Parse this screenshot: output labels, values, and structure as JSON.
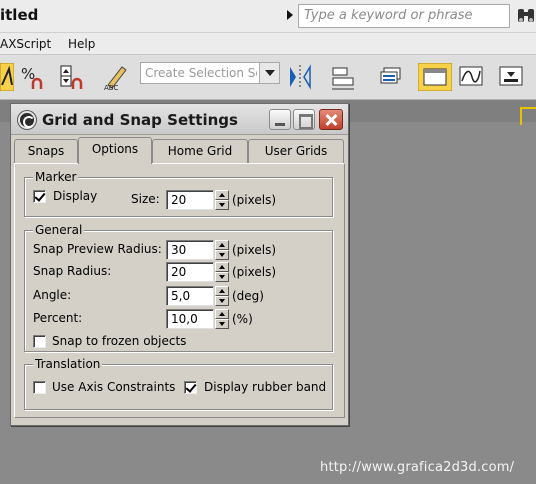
{
  "app": {
    "title": "itled",
    "search_placeholder": "Type a keyword or phrase",
    "menu": [
      "AXScript",
      "Help"
    ],
    "selection_set_placeholder": "Create Selection Se"
  },
  "dialog": {
    "title": "Grid and Snap Settings",
    "tabs": [
      {
        "label": "Snaps",
        "active": false
      },
      {
        "label": "Options",
        "active": true
      },
      {
        "label": "Home Grid",
        "active": false
      },
      {
        "label": "User Grids",
        "active": false
      }
    ],
    "marker": {
      "group_label": "Marker",
      "display_label": "Display",
      "display_checked": true,
      "size_label": "Size:",
      "size_value": "20",
      "size_unit": "(pixels)"
    },
    "general": {
      "group_label": "General",
      "snap_preview_radius_label": "Snap Preview Radius:",
      "snap_preview_radius_value": "30",
      "snap_preview_radius_unit": "(pixels)",
      "snap_radius_label": "Snap Radius:",
      "snap_radius_value": "20",
      "snap_radius_unit": "(pixels)",
      "angle_label": "Angle:",
      "angle_value": "5,0",
      "angle_unit": "(deg)",
      "percent_label": "Percent:",
      "percent_value": "10,0",
      "percent_unit": "(%)",
      "snap_frozen_label": "Snap to frozen objects",
      "snap_frozen_checked": false
    },
    "translation": {
      "group_label": "Translation",
      "use_axis_label": "Use Axis Constraints",
      "use_axis_checked": false,
      "rubber_band_label": "Display rubber band",
      "rubber_band_checked": true
    }
  },
  "watermark": "http://www.grafica2d3d.com/",
  "colors": {
    "viewport": "#8a8a8a",
    "dialog_bg": "#d4d0c8",
    "close_button": "#c0412c",
    "active_toolbar_highlight": "#f6d24a"
  }
}
